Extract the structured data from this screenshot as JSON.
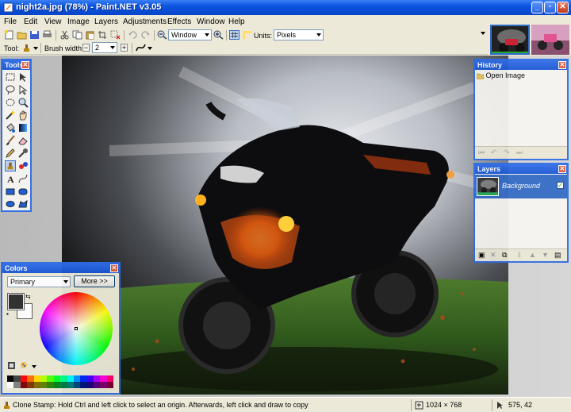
{
  "window": {
    "title": "night2a.jpg (78%) - Paint.NET v3.05"
  },
  "menu": [
    "File",
    "Edit",
    "View",
    "Image",
    "Layers",
    "Adjustments",
    "Effects",
    "Window",
    "Help"
  ],
  "toolbar": {
    "zoom_value": "Window",
    "units_label": "Units:",
    "units_value": "Pixels"
  },
  "toolbar2": {
    "tool_label": "Tool:",
    "brush_label": "Brush width:",
    "brush_value": "2"
  },
  "tools_panel": {
    "title": "Tools"
  },
  "history": {
    "title": "History",
    "items": [
      "Open Image"
    ]
  },
  "layers": {
    "title": "Layers",
    "items": [
      "Background"
    ]
  },
  "colors": {
    "title": "Colors",
    "mode": "Primary",
    "more_label": "More >>",
    "primary": "#2b2b2b",
    "secondary": "#ffffff"
  },
  "status": {
    "message": "Clone Stamp: Hold Ctrl and left click to select an origin. Afterwards, left click and draw to copy",
    "size": "1024 × 768",
    "pos": "575, 42"
  },
  "palette": [
    "#000000",
    "#404040",
    "#ff0000",
    "#ff6a00",
    "#ffd800",
    "#b6ff00",
    "#4cff00",
    "#00ff21",
    "#00ff90",
    "#00ffff",
    "#0094ff",
    "#0026ff",
    "#4800ff",
    "#b200ff",
    "#ff00dc",
    "#ff006e",
    "#ffffff",
    "#808080",
    "#7f0000",
    "#7f3300",
    "#7f6a00",
    "#5b7f00",
    "#267f00",
    "#007f0e",
    "#007f46",
    "#007f7f",
    "#004a7f",
    "#00137f",
    "#21007f",
    "#57007f",
    "#7f006e",
    "#7f0037"
  ]
}
